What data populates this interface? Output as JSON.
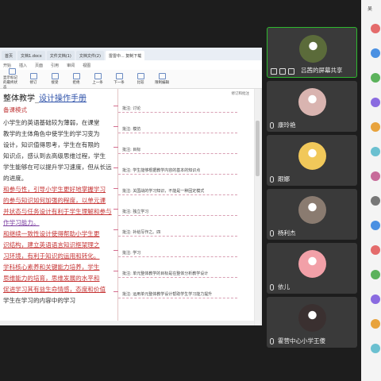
{
  "document_window": {
    "tabs": [
      "首页",
      "文档1.docx",
      "文件文档(1)",
      "文档文件(2)",
      "雷雷中... 复制下载"
    ],
    "menu": [
      "开始",
      "插入",
      "页面",
      "引用",
      "审阅",
      "视图"
    ],
    "toolbar": [
      {
        "label": "显示标记的最终状态",
        "icon": "markup-icon"
      },
      {
        "label": "修订",
        "icon": "track-changes-icon"
      },
      {
        "label": "接受",
        "icon": "accept-icon"
      },
      {
        "label": "拒绝",
        "icon": "reject-icon"
      },
      {
        "label": "上一条",
        "icon": "previous-icon"
      },
      {
        "label": "下一条",
        "icon": "next-icon"
      },
      {
        "label": "比较",
        "icon": "compare-icon"
      },
      {
        "label": "限制编辑",
        "icon": "restrict-icon"
      }
    ],
    "doc": {
      "title_prefix": "整体教学",
      "title_highlight": "设计操作手册",
      "subhead": "备课模式",
      "paragraphs": [
        {
          "text": "小学生的英语基础较为薄弱，在课堂",
          "style": "normal"
        },
        {
          "text": "教学的主体角色中使学生的学习变为",
          "style": "normal"
        },
        {
          "text": "设计，知识值得思考，学生在有限的",
          "style": "normal"
        },
        {
          "text": "知识点，感认到去高级思维过程，学生",
          "style": "normal"
        },
        {
          "text": "学生能够在可以提升学习速度，但从长远",
          "style": "normal"
        },
        {
          "text": "的进度。",
          "style": "normal"
        },
        {
          "text": "和参与性，引导小学生更好地掌握学习",
          "style": "red"
        },
        {
          "text": "的参与知识如何加强的程度，以单元课",
          "style": "red"
        },
        {
          "text": "并状态与任务设计有利于学生理解和参与",
          "style": "red"
        },
        {
          "text": "作学习能力。",
          "style": "purple"
        },
        {
          "text": "和继续一致性设计使得帮助小学生更",
          "style": "red"
        },
        {
          "text": "识结构，建立英语语言知识框架理之",
          "style": "red"
        },
        {
          "text": "习环境，有利于知识的运用和转化。",
          "style": "red"
        },
        {
          "text": "学科核心素养和关键能力培养，学生",
          "style": "red"
        },
        {
          "text": "思维能力的培育，思维发展的水平和",
          "style": "red"
        },
        {
          "text": "促进学习其有益生命情感，态度和价值",
          "style": "red"
        },
        {
          "text": "学生在学习的内容中的学习",
          "style": "normal"
        }
      ],
      "comments_header": "修订和批注",
      "comments": [
        "批注: 讨论",
        "批注: 模仿",
        "批注: 目标",
        "批注: 学生能够根据教学内容的基本的知识点",
        "批注: 关国战的学习知识，不能是一种固定模式",
        "批注: 独立学习",
        "批注: 补给写作之。四",
        "批注: 学习",
        "批注: 单元整体教学的目标是在整体分析教学设计",
        "批注: 运用单元整体教学设计帮助学生学习能力提升"
      ]
    }
  },
  "participants": [
    {
      "name": "吕茜的屏幕共享",
      "speaker": true,
      "avatar": "tree-photo-avatar"
    },
    {
      "name": "康玲艳",
      "avatar": "flowers-photo-avatar"
    },
    {
      "name": "跟娜",
      "avatar": "cartoon-girl-avatar"
    },
    {
      "name": "杨利杰",
      "avatar": "hand-photo-avatar"
    },
    {
      "name": "依儿",
      "avatar": "cartoon-baby-avatar"
    },
    {
      "name": "霍营中心小学王傻",
      "avatar": "woman-portrait-avatar"
    }
  ],
  "right_strip": {
    "label": "吴",
    "colors": [
      "#e46b6b",
      "#4a90e2",
      "#5bb25b",
      "#8a6be0",
      "#e8a33d",
      "#6bc0d0",
      "#c76b9a",
      "#777777",
      "#4a90e2",
      "#e46b6b",
      "#5bb25b",
      "#8a6be0",
      "#e8a33d",
      "#6bc0d0"
    ]
  }
}
